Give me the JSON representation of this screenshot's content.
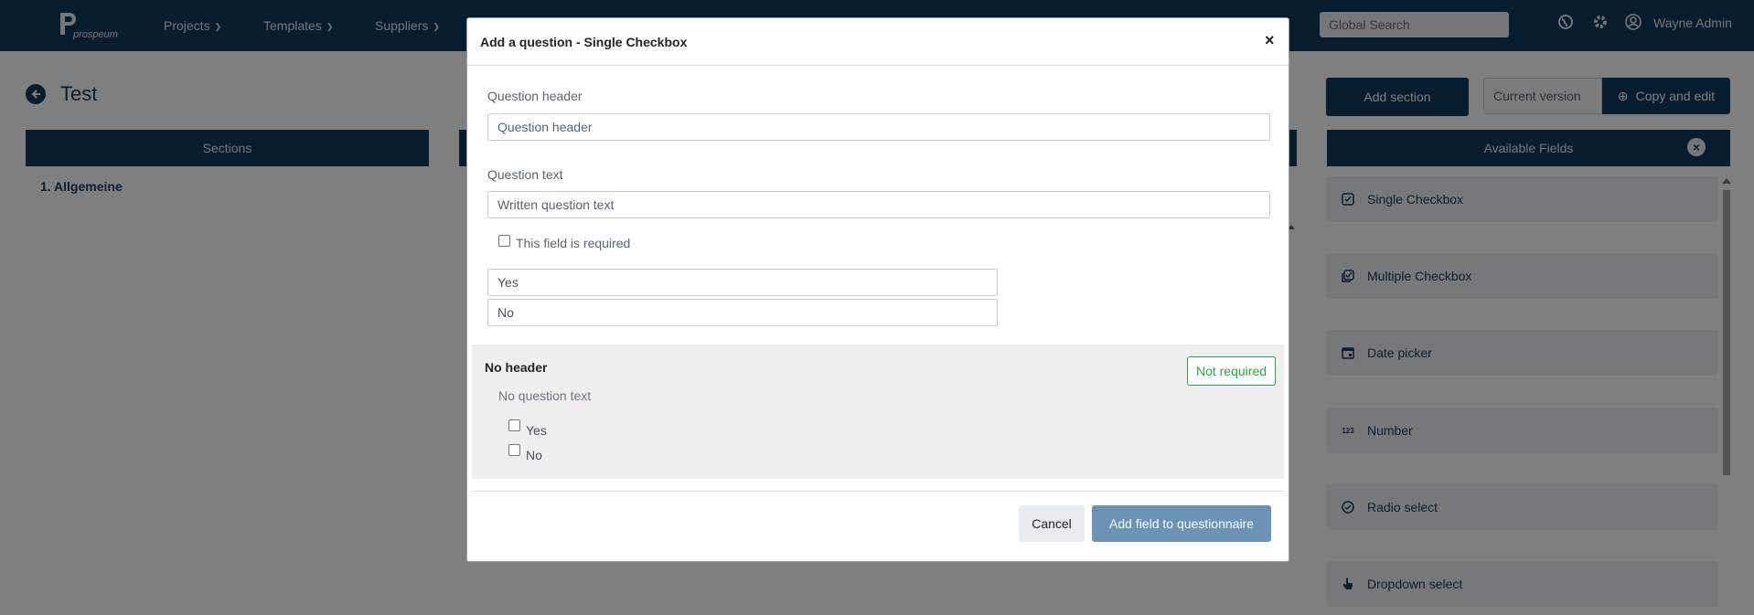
{
  "navbar": {
    "logo_text": "prospeum",
    "menu": [
      {
        "label": "Projects"
      },
      {
        "label": "Templates"
      },
      {
        "label": "Suppliers"
      }
    ],
    "search_placeholder": "Global Search",
    "user_name": "Wayne Admin"
  },
  "page": {
    "title": "Test",
    "sections_header": "Sections",
    "sections": [
      {
        "label": "1. Allgemeine"
      }
    ],
    "add_section_label": "Add section",
    "version_label": "Current version",
    "copy_edit_label": "Copy and edit",
    "available_fields_header": "Available Fields",
    "available_fields": [
      {
        "label": "Single Checkbox",
        "icon": "checkbox-icon"
      },
      {
        "label": "Multiple Checkbox",
        "icon": "multi-checkbox-icon"
      },
      {
        "label": "Date picker",
        "icon": "calendar-icon"
      },
      {
        "label": "Number",
        "icon": "number-icon",
        "icon_text": "123"
      },
      {
        "label": "Radio select",
        "icon": "radio-check-icon"
      },
      {
        "label": "Dropdown select",
        "icon": "hand-pointer-icon"
      }
    ]
  },
  "modal": {
    "title": "Add a question - Single Checkbox",
    "close_symbol": "×",
    "question_header_label": "Question header",
    "question_header_placeholder": "Question header",
    "question_text_label": "Question text",
    "question_text_placeholder": "Written question text",
    "required_label": "This field is required",
    "options": [
      {
        "value": "Yes"
      },
      {
        "value": "No"
      }
    ],
    "preview": {
      "header": "No header",
      "badge": "Not required",
      "text": "No question text",
      "options": [
        {
          "label": "Yes"
        },
        {
          "label": "No"
        }
      ]
    },
    "cancel_label": "Cancel",
    "submit_label": "Add field to questionnaire"
  },
  "colors": {
    "primary": "#0e3a5c",
    "submit": "#6a93b5",
    "success": "#28a745",
    "overlay": "rgba(0,0,0,0.5)"
  }
}
